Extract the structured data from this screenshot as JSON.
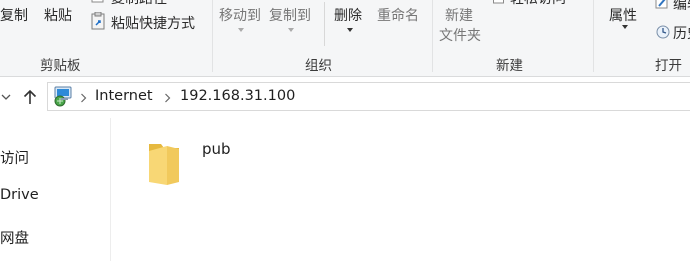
{
  "ribbon": {
    "clipboard": {
      "copy_label": "复制",
      "paste_label": "粘贴",
      "copy_path_label": "复制路径",
      "paste_shortcut_label": "粘贴快捷方式",
      "group_label": "剪贴板"
    },
    "organize": {
      "move_to_label": "移动到",
      "copy_to_label": "复制到",
      "delete_label": "删除",
      "rename_label": "重命名",
      "group_label": "组织"
    },
    "new": {
      "new_folder_line1": "新建",
      "new_folder_line2": "文件夹",
      "easy_access_label": "轻松访问",
      "group_label": "新建"
    },
    "open": {
      "properties_label": "属性",
      "edit_label": "编辑",
      "history_label": "历史",
      "group_label": "打开"
    }
  },
  "address": {
    "crumbs": [
      "Internet",
      "192.168.31.100"
    ]
  },
  "nav_pane": {
    "items": [
      "访问",
      "Drive",
      "网盘"
    ]
  },
  "files": [
    {
      "name": "pub",
      "type": "folder"
    }
  ],
  "colors": {
    "folder_yellow": "#f8d775",
    "folder_dark": "#e6b93f",
    "ribbon_bg": "#f5f6f7"
  }
}
